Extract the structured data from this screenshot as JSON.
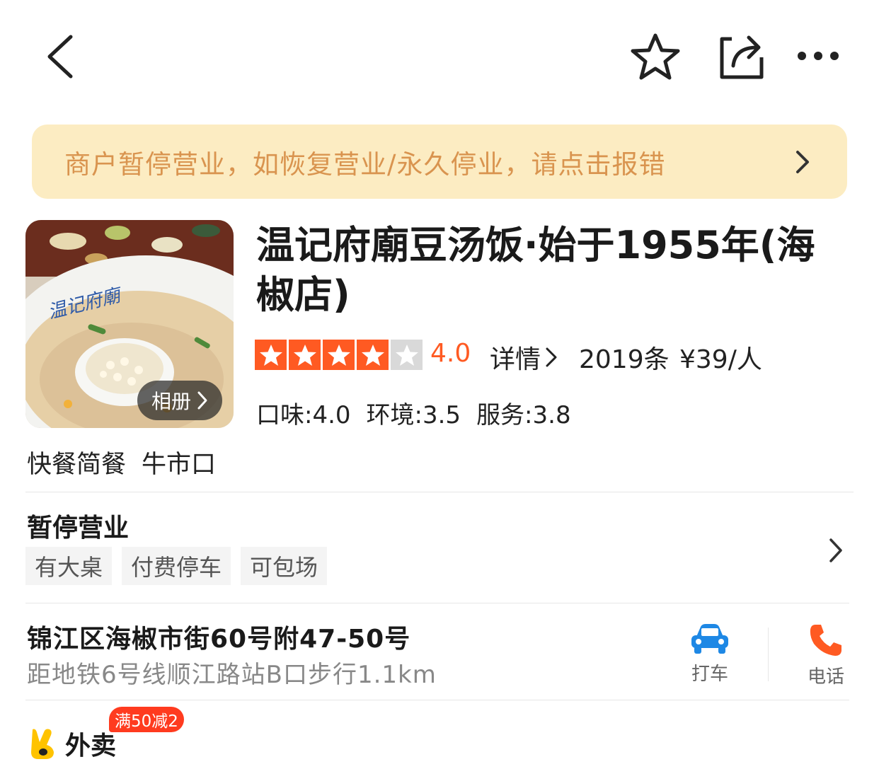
{
  "nav": {
    "back_icon": "back-arrow-icon",
    "favorite_icon": "star-outline-icon",
    "share_icon": "share-icon",
    "more_icon": "more-dots-icon"
  },
  "notice": {
    "text": "商户暂停营业，如恢复营业/永久停业，请点击报错"
  },
  "shop": {
    "album_label": "相册",
    "name": "温记府廟豆汤饭·始于1955年(海椒店)",
    "rating_value": "4.0",
    "rating_stars": 4,
    "rating_max": 5,
    "detail_label": "详情",
    "review_count": "2019条",
    "price": "¥39/人",
    "scores": [
      "口味:4.0",
      "环境:3.5",
      "服务:3.8"
    ],
    "category": "快餐简餐",
    "area": "牛市口"
  },
  "status": {
    "label": "暂停营业",
    "tags": [
      "有大桌",
      "付费停车",
      "可包场"
    ]
  },
  "location": {
    "address": "锦江区海椒市街60号附47-50号",
    "distance": "距地铁6号线顺江路站B口步行1.1km",
    "taxi_label": "打车",
    "phone_label": "电话"
  },
  "delivery": {
    "title": "外卖",
    "promo": "满50减2"
  },
  "colors": {
    "accent": "#ff5a22",
    "notice_bg": "#fcecc2",
    "notice_text": "#d9944f",
    "taxi_blue": "#1e88e5"
  }
}
